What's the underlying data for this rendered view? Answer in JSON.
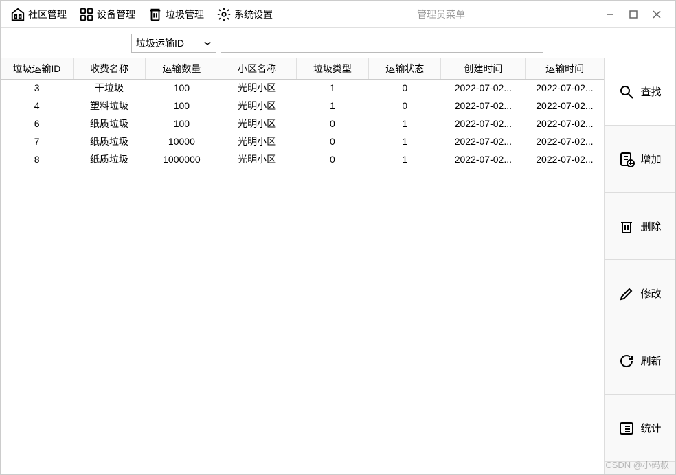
{
  "window": {
    "title": "管理员菜单"
  },
  "menu": {
    "community": "社区管理",
    "device": "设备管理",
    "trash": "垃圾管理",
    "system": "系统设置"
  },
  "toolbar": {
    "filter_field": "垃圾运输ID",
    "search_value": ""
  },
  "table": {
    "headers": {
      "c0": "垃圾运输ID",
      "c1": "收费名称",
      "c2": "运输数量",
      "c3": "小区名称",
      "c4": "垃圾类型",
      "c5": "运输状态",
      "c6": "创建时间",
      "c7": "运输时间"
    },
    "rows": [
      {
        "c0": "3",
        "c1": "干垃圾",
        "c2": "100",
        "c3": "光明小区",
        "c4": "1",
        "c5": "0",
        "c6": "2022-07-02...",
        "c7": "2022-07-02..."
      },
      {
        "c0": "4",
        "c1": "塑料垃圾",
        "c2": "100",
        "c3": "光明小区",
        "c4": "1",
        "c5": "0",
        "c6": "2022-07-02...",
        "c7": "2022-07-02..."
      },
      {
        "c0": "6",
        "c1": "纸质垃圾",
        "c2": "100",
        "c3": "光明小区",
        "c4": "0",
        "c5": "1",
        "c6": "2022-07-02...",
        "c7": "2022-07-02..."
      },
      {
        "c0": "7",
        "c1": "纸质垃圾",
        "c2": "10000",
        "c3": "光明小区",
        "c4": "0",
        "c5": "1",
        "c6": "2022-07-02...",
        "c7": "2022-07-02..."
      },
      {
        "c0": "8",
        "c1": "纸质垃圾",
        "c2": "1000000",
        "c3": "光明小区",
        "c4": "0",
        "c5": "1",
        "c6": "2022-07-02...",
        "c7": "2022-07-02..."
      }
    ]
  },
  "sidebar": {
    "search": "查找",
    "add": "增加",
    "delete": "删除",
    "edit": "修改",
    "refresh": "刷新",
    "stats": "统计"
  },
  "watermark": "CSDN @小码叔"
}
